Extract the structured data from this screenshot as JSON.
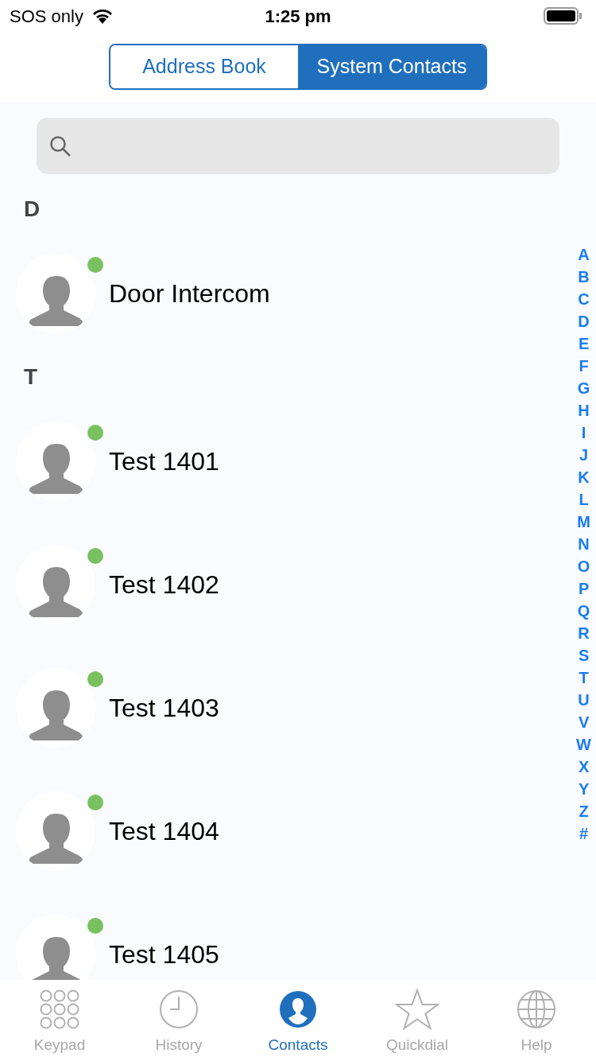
{
  "status_bar": {
    "carrier": "SOS only",
    "time": "1:25 pm"
  },
  "segments": [
    {
      "label": "Address Book",
      "selected": false
    },
    {
      "label": "System Contacts",
      "selected": true
    }
  ],
  "sections": [
    {
      "letter": "D",
      "contacts": [
        {
          "name": "Door Intercom",
          "color": "#79c160"
        }
      ]
    },
    {
      "letter": "T",
      "contacts": [
        {
          "name": "Test 1401",
          "color": "#79c160"
        },
        {
          "name": "Test 1402",
          "color": "#79c160"
        },
        {
          "name": "Test 1403",
          "color": "#79c160"
        },
        {
          "name": "Test 1404",
          "color": "#79c160"
        },
        {
          "name": "Test 1405",
          "color": "#79c160"
        }
      ]
    }
  ],
  "index": [
    "A",
    "B",
    "C",
    "D",
    "E",
    "F",
    "G",
    "H",
    "I",
    "J",
    "K",
    "L",
    "M",
    "N",
    "O",
    "P",
    "Q",
    "R",
    "S",
    "T",
    "U",
    "V",
    "W",
    "X",
    "Y",
    "Z",
    "#"
  ],
  "tab_bar": [
    {
      "kind": "keypad",
      "label": "Keypad",
      "selected": false
    },
    {
      "kind": "history",
      "label": "History",
      "selected": false
    },
    {
      "kind": "contacts",
      "label": "Contacts",
      "selected": true
    },
    {
      "kind": "quickdial",
      "label": "Quickdial",
      "selected": false
    },
    {
      "kind": "help",
      "label": "Help",
      "selected": false
    }
  ]
}
